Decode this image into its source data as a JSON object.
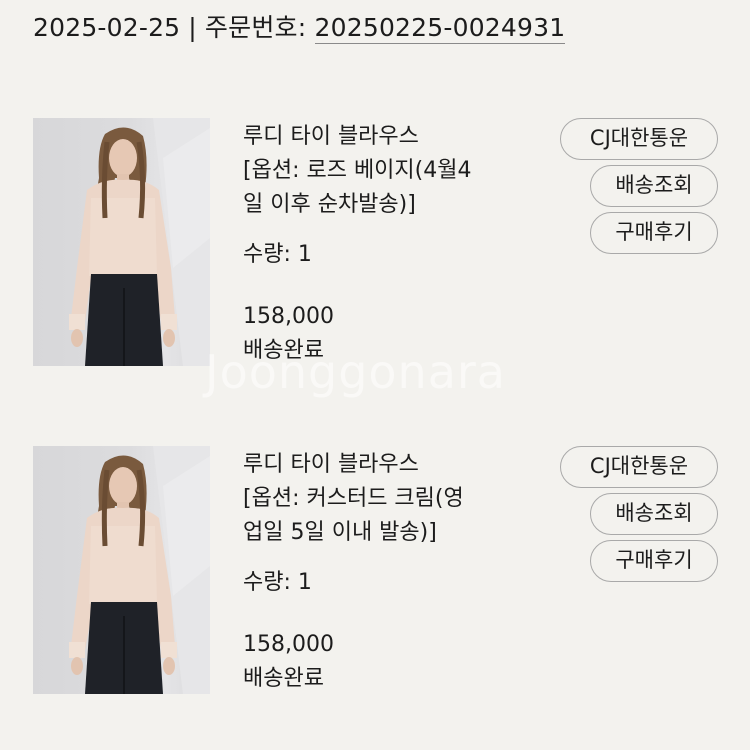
{
  "header": {
    "date": "2025-02-25",
    "separator": "|",
    "order_label": "주문번호:",
    "order_number": "20250225-0024931"
  },
  "items": [
    {
      "title": "루디 타이 블라우스",
      "option_line1": "[옵션: 로즈 베이지(4월4",
      "option_line2": "일 이후 순차발송)]",
      "quantity": "수량: 1",
      "price": "158,000",
      "status": "배송완료",
      "buttons": {
        "carrier": "CJ대한통운",
        "track": "배송조회",
        "review": "구매후기"
      }
    },
    {
      "title": "루디 타이 블라우스",
      "option_line1": "[옵션: 커스터드 크림(영",
      "option_line2": "업일 5일 이내 발송)]",
      "quantity": "수량: 1",
      "price": "158,000",
      "status": "배송완료",
      "buttons": {
        "carrier": "CJ대한통운",
        "track": "배송조회",
        "review": "구매후기"
      }
    }
  ],
  "watermark": "Joonggonara",
  "colors": {
    "background": "#f3f2ee",
    "text": "#1c1c1c",
    "button_border": "#a9a9a9"
  }
}
